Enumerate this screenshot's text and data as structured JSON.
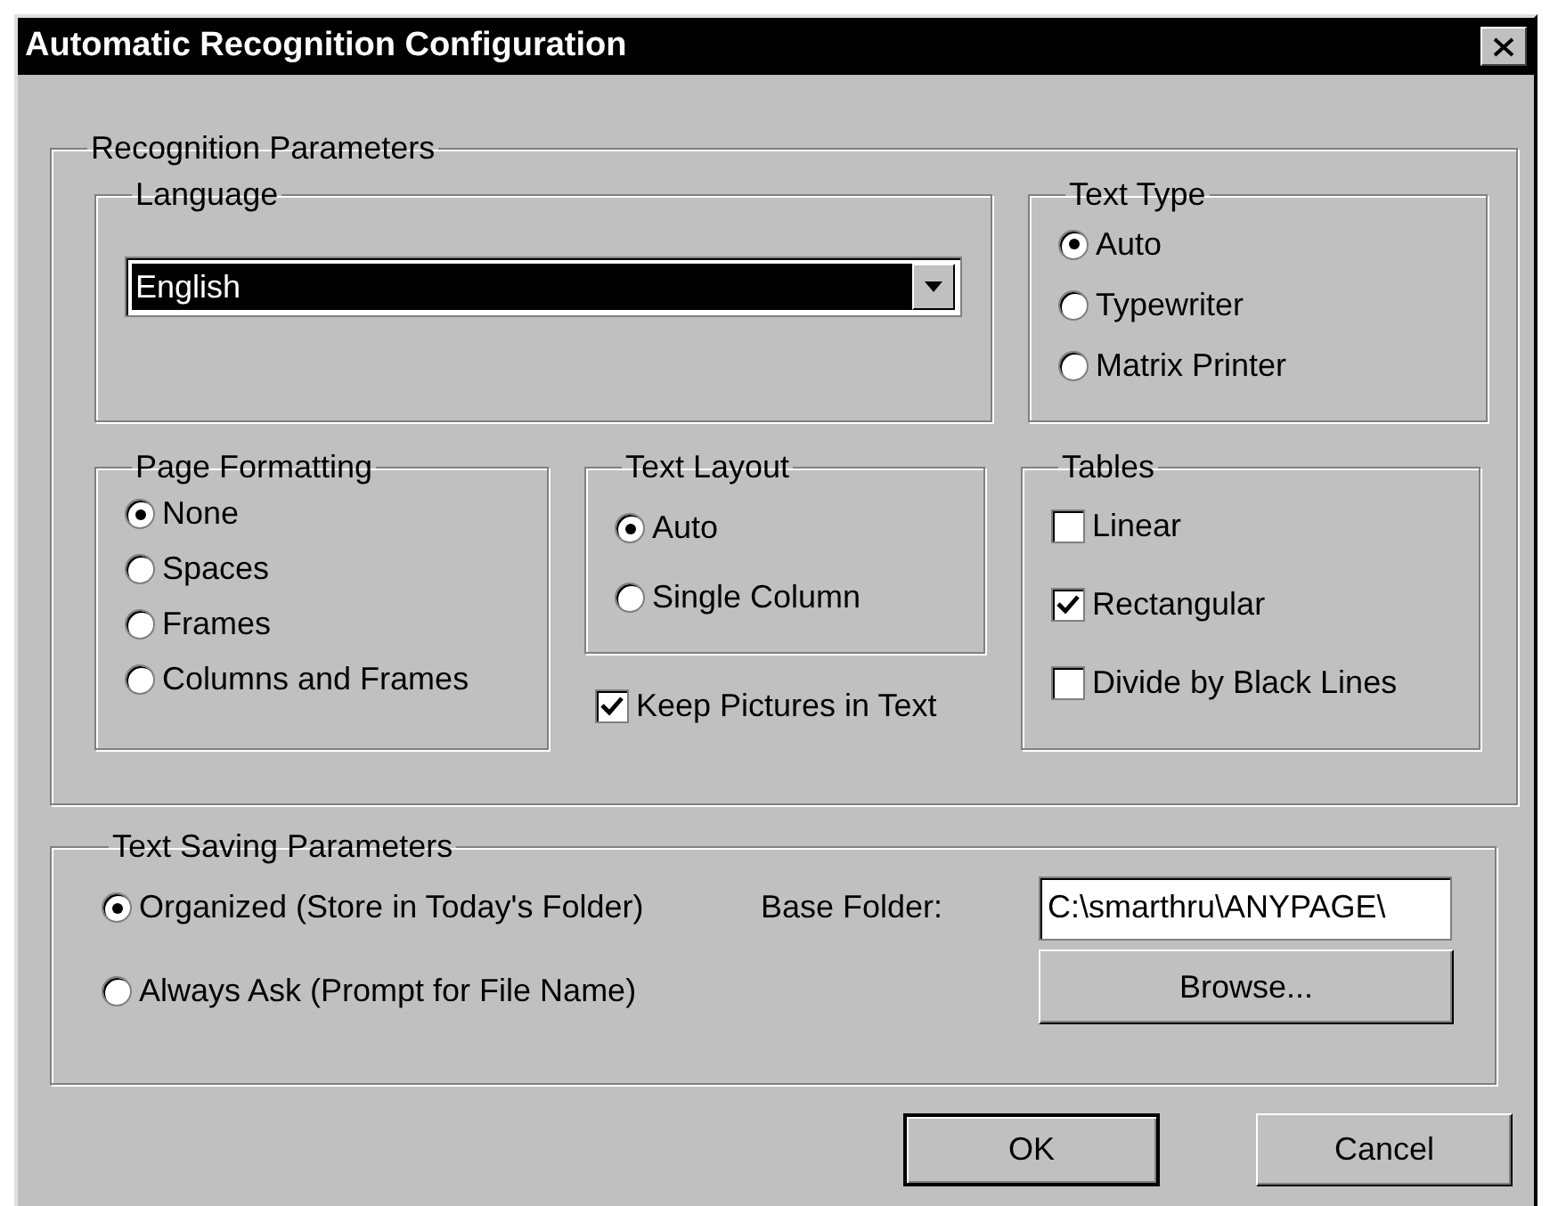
{
  "window": {
    "title": "Automatic Recognition Configuration"
  },
  "recognition_parameters": {
    "title": "Recognition Parameters",
    "language": {
      "title": "Language",
      "value": "English"
    },
    "text_type": {
      "title": "Text Type",
      "options": [
        {
          "label": "Auto",
          "selected": true
        },
        {
          "label": "Typewriter",
          "selected": false
        },
        {
          "label": "Matrix Printer",
          "selected": false
        }
      ]
    },
    "page_formatting": {
      "title": "Page Formatting",
      "options": [
        {
          "label": "None",
          "selected": true
        },
        {
          "label": "Spaces",
          "selected": false
        },
        {
          "label": "Frames",
          "selected": false
        },
        {
          "label": "Columns and Frames",
          "selected": false
        }
      ]
    },
    "text_layout": {
      "title": "Text Layout",
      "options": [
        {
          "label": "Auto",
          "selected": true
        },
        {
          "label": "Single Column",
          "selected": false
        }
      ]
    },
    "keep_pictures": {
      "label": "Keep Pictures in Text",
      "checked": true
    },
    "tables": {
      "title": "Tables",
      "options": [
        {
          "label": "Linear",
          "checked": false
        },
        {
          "label": "Rectangular",
          "checked": true
        },
        {
          "label": "Divide by Black Lines",
          "checked": false
        }
      ]
    }
  },
  "text_saving": {
    "title": "Text Saving Parameters",
    "options": [
      {
        "label": "Organized (Store in Today's Folder)",
        "selected": true
      },
      {
        "label": "Always Ask (Prompt for File Name)",
        "selected": false
      }
    ],
    "base_folder": {
      "label": "Base Folder:",
      "value": "C:\\smarthru\\ANYPAGE\\"
    },
    "browse": "Browse..."
  },
  "buttons": [
    {
      "label": "OK",
      "default": true
    },
    {
      "label": "Cancel",
      "default": false
    }
  ]
}
